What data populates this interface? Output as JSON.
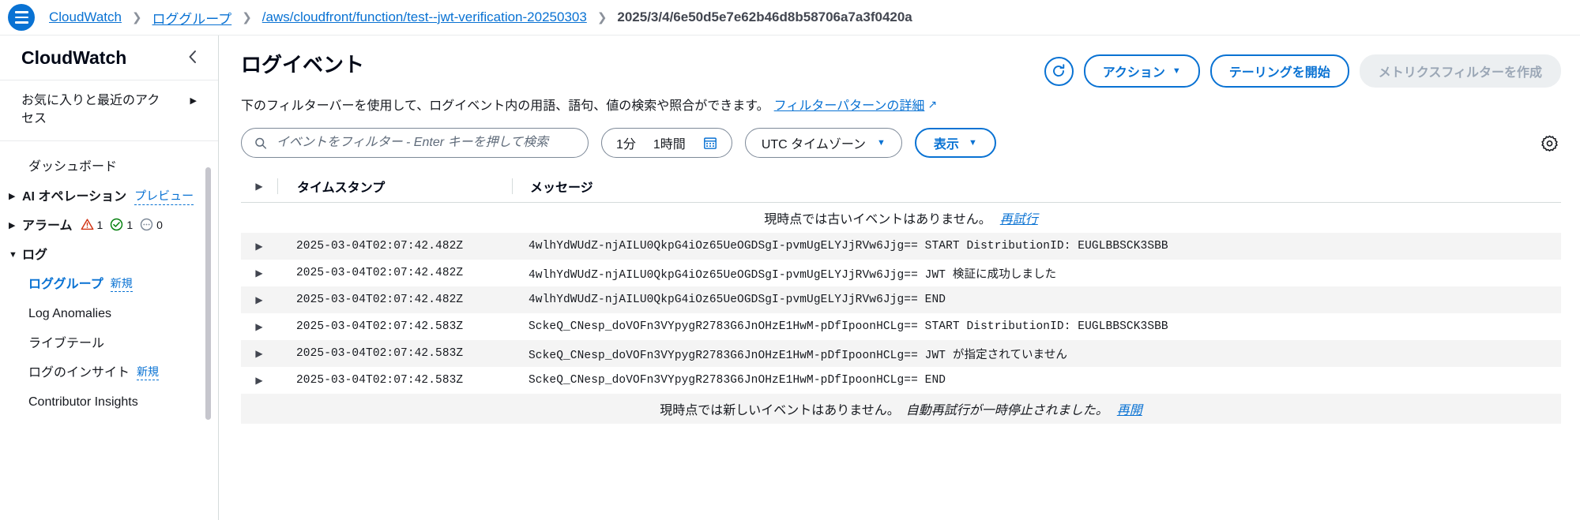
{
  "breadcrumb": {
    "menu_icon": "hamburger-menu-icon",
    "items": [
      {
        "label": "CloudWatch",
        "current": false
      },
      {
        "label": "ロググループ",
        "current": false
      },
      {
        "label": "/aws/cloudfront/function/test--jwt-verification-20250303",
        "current": false
      },
      {
        "label": "2025/3/4/6e50d5e7e62b46d8b58706a7a3f0420a",
        "current": true
      }
    ],
    "separator": "❯"
  },
  "sidebar": {
    "title": "CloudWatch",
    "collapse_icon": "chevron-left-icon",
    "favorites_label": "お気に入りと最近のアクセス",
    "favorites_arrow": "▶",
    "items": [
      {
        "label": "ダッシュボード",
        "caret": "",
        "bold": false,
        "active": false,
        "indent": true,
        "badge": ""
      },
      {
        "label": "AI オペレーション",
        "caret": "▶",
        "bold": true,
        "active": false,
        "indent": false,
        "badge": "プレビュー"
      },
      {
        "label": "アラーム",
        "caret": "▶",
        "bold": true,
        "active": false,
        "indent": false,
        "badge": "",
        "alarms": true
      },
      {
        "label": "ログ",
        "caret": "▼",
        "bold": true,
        "active": false,
        "indent": false,
        "badge": ""
      },
      {
        "label": "ロググループ",
        "caret": "",
        "bold": false,
        "active": true,
        "indent": true,
        "badge": "新規"
      },
      {
        "label": "Log Anomalies",
        "caret": "",
        "bold": false,
        "active": false,
        "indent": true,
        "badge": ""
      },
      {
        "label": "ライブテール",
        "caret": "",
        "bold": false,
        "active": false,
        "indent": true,
        "badge": ""
      },
      {
        "label": "ログのインサイト",
        "caret": "",
        "bold": false,
        "active": false,
        "indent": true,
        "badge": "新規"
      },
      {
        "label": "Contributor Insights",
        "caret": "",
        "bold": false,
        "active": false,
        "indent": true,
        "badge": ""
      }
    ],
    "alarm_counts": [
      {
        "icon": "alarm-warning-icon",
        "value": "1",
        "color": "#d13212"
      },
      {
        "icon": "alarm-ok-icon",
        "value": "1",
        "color": "#037f0c"
      },
      {
        "icon": "alarm-insufficient-icon",
        "value": "0",
        "color": "#7d8998"
      }
    ]
  },
  "header": {
    "title": "ログイベント",
    "description": "下のフィルターバーを使用して、ログイベント内の用語、語句、値の検索や照合ができます。",
    "description_link": "フィルターパターンの詳細",
    "external_glyph": "↗",
    "refresh_icon": "refresh-icon",
    "actions_label": "アクション",
    "tail_label": "テーリングを開始",
    "metric_filter_label": "メトリクスフィルターを作成",
    "caret": "▼"
  },
  "filters": {
    "search_icon": "search-icon",
    "search_value": "",
    "search_placeholder": "イベントをフィルター - Enter キーを押して検索",
    "range_minute": "1分",
    "range_hour": "1時間",
    "calendar_icon": "calendar-icon",
    "timezone_label": "UTC タイムゾーン",
    "display_label": "表示",
    "caret": "▼",
    "settings_icon": "gear-icon"
  },
  "table": {
    "expand_icon": "▶",
    "columns": {
      "timestamp": "タイムスタンプ",
      "message": "メッセージ"
    },
    "top_notice": {
      "text": "現時点では古いイベントはありません。",
      "link": "再試行"
    },
    "rows": [
      {
        "timestamp": "2025-03-04T02:07:42.482Z",
        "message": "4wlhYdWUdZ-njAILU0QkpG4iOz65UeOGDSgI-pvmUgELYJjRVw6Jjg== START DistributionID: EUGLBBSCK3SBB"
      },
      {
        "timestamp": "2025-03-04T02:07:42.482Z",
        "message": "4wlhYdWUdZ-njAILU0QkpG4iOz65UeOGDSgI-pvmUgELYJjRVw6Jjg== JWT 検証に成功しました"
      },
      {
        "timestamp": "2025-03-04T02:07:42.482Z",
        "message": "4wlhYdWUdZ-njAILU0QkpG4iOz65UeOGDSgI-pvmUgELYJjRVw6Jjg== END"
      },
      {
        "timestamp": "2025-03-04T02:07:42.583Z",
        "message": "SckeQ_CNesp_doVOFn3VYpygR2783G6JnOHzE1HwM-pDfIpoonHCLg== START DistributionID: EUGLBBSCK3SBB"
      },
      {
        "timestamp": "2025-03-04T02:07:42.583Z",
        "message": "SckeQ_CNesp_doVOFn3VYpygR2783G6JnOHzE1HwM-pDfIpoonHCLg== JWT が指定されていません"
      },
      {
        "timestamp": "2025-03-04T02:07:42.583Z",
        "message": "SckeQ_CNesp_doVOFn3VYpygR2783G6JnOHzE1HwM-pDfIpoonHCLg== END"
      }
    ],
    "bottom_notice": {
      "text": "現時点では新しいイベントはありません。",
      "emphasis": "自動再試行が一時停止されました。",
      "link": "再開"
    }
  },
  "colors": {
    "accent": "#0972d3",
    "row_shade": "#f4f4f4",
    "border": "#d5dbdb",
    "alarm_red": "#d13212",
    "alarm_green": "#037f0c",
    "alarm_grey": "#7d8998"
  }
}
